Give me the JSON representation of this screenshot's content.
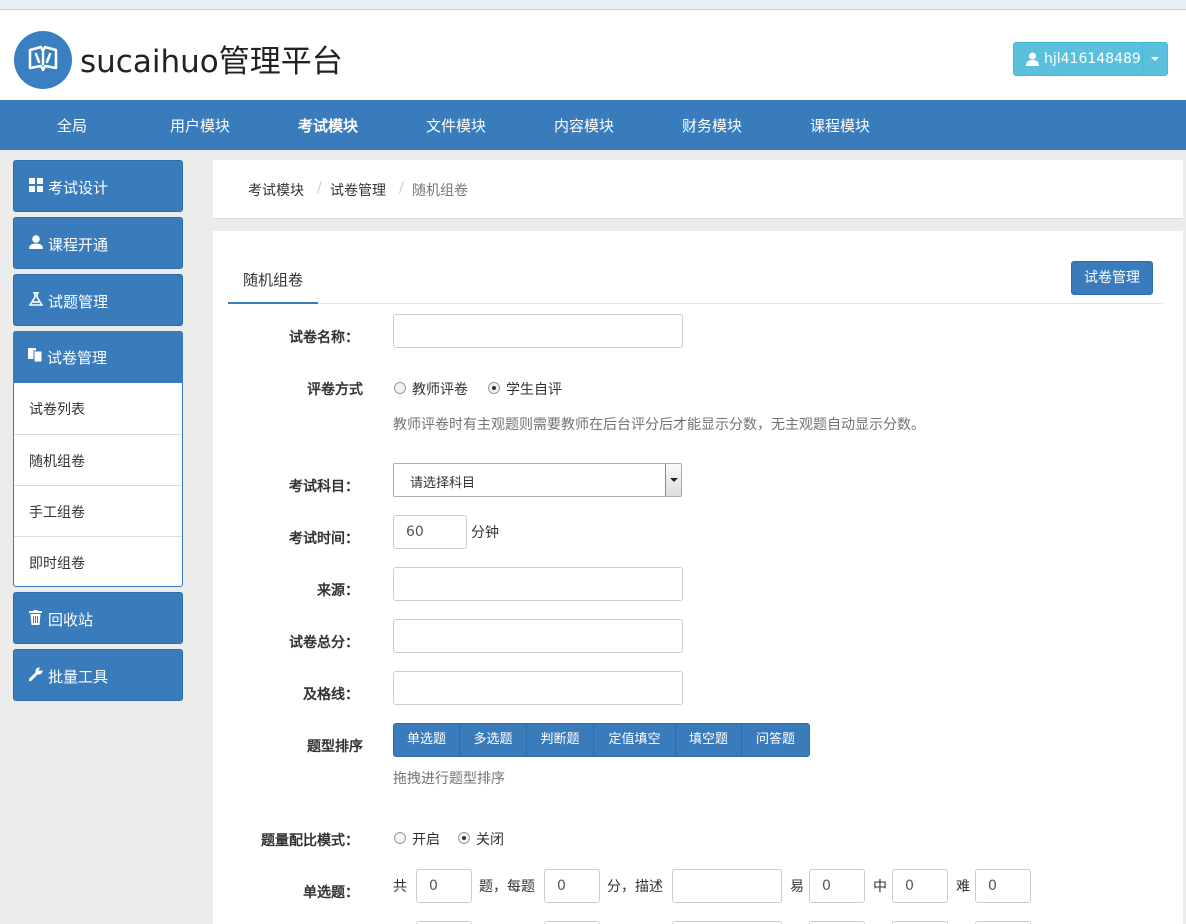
{
  "header": {
    "brand": "sucaihuo管理平台",
    "user": "hjl416148489"
  },
  "nav": {
    "items": [
      {
        "label": "全局"
      },
      {
        "label": "用户模块"
      },
      {
        "label": "考试模块"
      },
      {
        "label": "文件模块"
      },
      {
        "label": "内容模块"
      },
      {
        "label": "财务模块"
      },
      {
        "label": "课程模块"
      }
    ],
    "active": "考试模块"
  },
  "sidebar": {
    "blocks": [
      {
        "label": "考试设计",
        "icon": "grid-icon"
      },
      {
        "label": "课程开通",
        "icon": "user-icon"
      },
      {
        "label": "试题管理",
        "icon": "flask-icon"
      },
      {
        "label": "试卷管理",
        "icon": "files-icon"
      },
      {
        "label": "回收站",
        "icon": "trash-icon"
      },
      {
        "label": "批量工具",
        "icon": "wrench-icon"
      }
    ],
    "sub_items": [
      {
        "label": "试卷列表"
      },
      {
        "label": "随机组卷"
      },
      {
        "label": "手工组卷"
      },
      {
        "label": "即时组卷"
      }
    ]
  },
  "breadcrumb": {
    "items": [
      "考试模块",
      "试卷管理",
      "随机组卷"
    ],
    "separator": "/"
  },
  "panel": {
    "tab": "随机组卷",
    "manage_button": "试卷管理"
  },
  "form": {
    "name_label": "试卷名称：",
    "grading_label": "评卷方式",
    "grading_options": [
      "教师评卷",
      "学生自评"
    ],
    "grading_selected": "学生自评",
    "grading_help": "教师评卷时有主观题则需要教师在后台评分后才能显示分数，无主观题自动显示分数。",
    "subject_label": "考试科目：",
    "subject_value": "请选择科目",
    "time_label": "考试时间：",
    "time_value": "60",
    "time_unit": "分钟",
    "source_label": "来源：",
    "total_label": "试卷总分：",
    "pass_label": "及格线：",
    "order_label": "题型排序",
    "types": [
      "单选题",
      "多选题",
      "判断题",
      "定值填空",
      "填空题",
      "问答题"
    ],
    "order_help": "拖拽进行题型排序",
    "ratio_label": "题量配比模式：",
    "ratio_options": [
      "开启",
      "关闭"
    ],
    "ratio_selected": "关闭",
    "single_label": "单选题：",
    "single": {
      "t_total": "共",
      "total": "0",
      "t_each": "题，每题",
      "each": "0",
      "t_desc": "分，描述",
      "desc": "",
      "t_easy": "易",
      "easy": "0",
      "t_mid": "中",
      "mid": "0",
      "t_hard": "难",
      "hard": "0"
    }
  },
  "colors": {
    "primary": "#3a7bbb",
    "info": "#5bc0de"
  }
}
